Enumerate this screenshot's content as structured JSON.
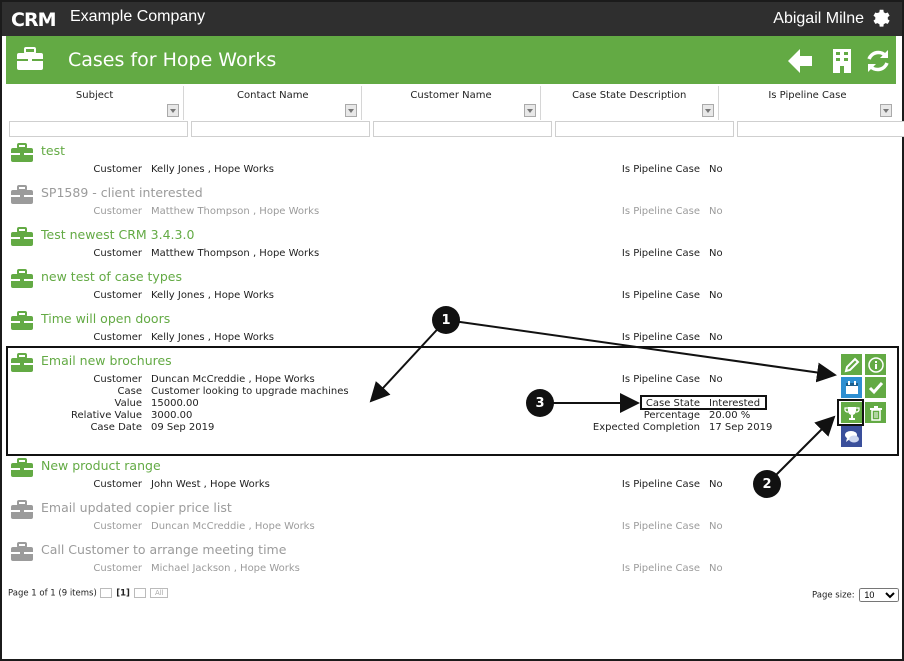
{
  "app": {
    "logo_text": "CRM",
    "company": "Example Company",
    "user": "Abigail Milne"
  },
  "page": {
    "title": "Cases for Hope Works"
  },
  "columns": [
    "Subject",
    "Contact Name",
    "Customer Name",
    "Case State Description",
    "Is Pipeline Case"
  ],
  "labels": {
    "customer": "Customer",
    "case": "Case",
    "value": "Value",
    "relative_value": "Relative Value",
    "case_date": "Case Date",
    "pipeline": "Is Pipeline Case",
    "case_state": "Case State",
    "percentage": "Percentage",
    "expected_completion": "Expected Completion"
  },
  "cases": [
    {
      "title": "test",
      "customer": "Kelly Jones , Hope Works",
      "pipeline": "No",
      "active": true
    },
    {
      "title": "SP1589 - client interested",
      "customer": "Matthew Thompson , Hope Works",
      "pipeline": "No",
      "active": false
    },
    {
      "title": "Test newest CRM 3.4.3.0",
      "customer": "Matthew Thompson , Hope Works",
      "pipeline": "No",
      "active": true
    },
    {
      "title": "new test of case types",
      "customer": "Kelly Jones , Hope Works",
      "pipeline": "No",
      "active": true
    },
    {
      "title": "Time will open doors",
      "customer": "Kelly Jones , Hope Works",
      "pipeline": "No",
      "active": true
    },
    {
      "title": "Email new brochures",
      "customer": "Duncan McCreddie , Hope Works",
      "pipeline": "No",
      "active": true,
      "case": "Customer looking to upgrade machines",
      "value": "15000.00",
      "relative_value": "3000.00",
      "case_date": "09 Sep 2019",
      "case_state": "Interested",
      "percentage": "20.00 %",
      "expected_completion": "17 Sep 2019"
    },
    {
      "title": "New product range",
      "customer": "John West , Hope Works",
      "pipeline": "No",
      "active": true
    },
    {
      "title": "Email updated copier price list",
      "customer": "Duncan McCreddie , Hope Works",
      "pipeline": "No",
      "active": false
    },
    {
      "title": "Call Customer to arrange meeting time",
      "customer": "Michael Jackson , Hope Works",
      "pipeline": "No",
      "active": false
    }
  ],
  "callouts": [
    "1",
    "2",
    "3"
  ],
  "pager": {
    "summary": "Page 1 of 1 (9 items)",
    "current": "[1]",
    "all_label": "All",
    "page_size_label": "Page size:",
    "page_size": "10"
  },
  "colors": {
    "brand_green": "#63aa44",
    "topbar": "#2f2f2f",
    "inactive_grey": "#9b9b9b",
    "edit_blue": "#2e8fd1",
    "chat_blue": "#3a4f9b"
  }
}
